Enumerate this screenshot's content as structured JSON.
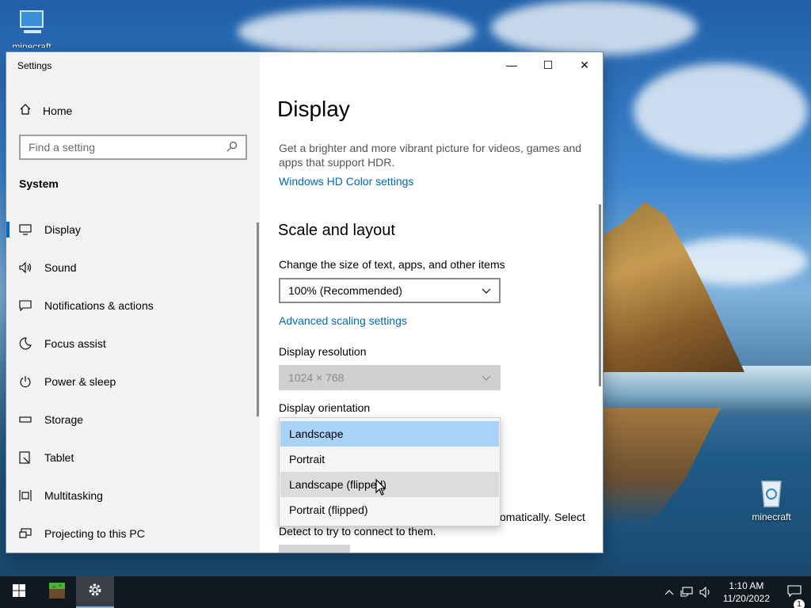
{
  "desktop": {
    "icons": [
      {
        "label": "minecraft"
      },
      {
        "label": "minecraft"
      }
    ]
  },
  "window": {
    "title": "Settings",
    "controls": {
      "minimize": "—",
      "maximize": "☐",
      "close": "✕"
    }
  },
  "sidebar": {
    "home_label": "Home",
    "search_placeholder": "Find a setting",
    "section_label": "System",
    "items": [
      {
        "label": "Display",
        "icon": "monitor-icon"
      },
      {
        "label": "Sound",
        "icon": "speaker-icon"
      },
      {
        "label": "Notifications & actions",
        "icon": "notification-icon"
      },
      {
        "label": "Focus assist",
        "icon": "moon-icon"
      },
      {
        "label": "Power & sleep",
        "icon": "power-icon"
      },
      {
        "label": "Storage",
        "icon": "storage-icon"
      },
      {
        "label": "Tablet",
        "icon": "tablet-icon"
      },
      {
        "label": "Multitasking",
        "icon": "multitasking-icon"
      },
      {
        "label": "Projecting to this PC",
        "icon": "projector-icon"
      }
    ]
  },
  "main": {
    "title": "Display",
    "hdr_description": "Get a brighter and more vibrant picture for videos, games and apps that support HDR.",
    "hdr_link": "Windows HD Color settings",
    "scale_heading": "Scale and layout",
    "scale_label": "Change the size of text, apps, and other items",
    "scale_value": "100% (Recommended)",
    "advanced_scaling_link": "Advanced scaling settings",
    "resolution_label": "Display resolution",
    "resolution_value": "1024 × 768",
    "orientation_label": "Display orientation",
    "orientation_options": [
      "Landscape",
      "Portrait",
      "Landscape (flipped)",
      "Portrait (flipped)"
    ],
    "partial_text_1": "omatically. Select",
    "partial_text_2": "Detect to try to connect to them."
  },
  "taskbar": {
    "time": "1:10 AM",
    "date": "11/20/2022",
    "notification_count": "1"
  },
  "colors": {
    "accent": "#0067c0",
    "selected_option": "#a9d2f7"
  }
}
